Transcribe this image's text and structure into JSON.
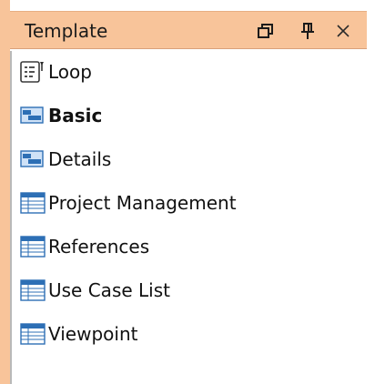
{
  "panel": {
    "title": "Template",
    "header_buttons": [
      {
        "name": "restore-icon"
      },
      {
        "name": "pin-icon"
      },
      {
        "name": "close-icon"
      }
    ]
  },
  "items": [
    {
      "label": "Loop",
      "icon": "loop-template-icon",
      "bold": false
    },
    {
      "label": "Basic",
      "icon": "form-template-icon",
      "bold": true
    },
    {
      "label": "Details",
      "icon": "form-template-icon",
      "bold": false
    },
    {
      "label": "Project Management",
      "icon": "table-template-icon",
      "bold": false
    },
    {
      "label": "References",
      "icon": "table-template-icon",
      "bold": false
    },
    {
      "label": "Use Case List",
      "icon": "table-template-icon",
      "bold": false
    },
    {
      "label": "Viewpoint",
      "icon": "table-template-icon",
      "bold": false
    }
  ],
  "colors": {
    "header_bg": "#f8c49a",
    "text": "#111111",
    "table_icon_blue": "#2d6fb5"
  }
}
